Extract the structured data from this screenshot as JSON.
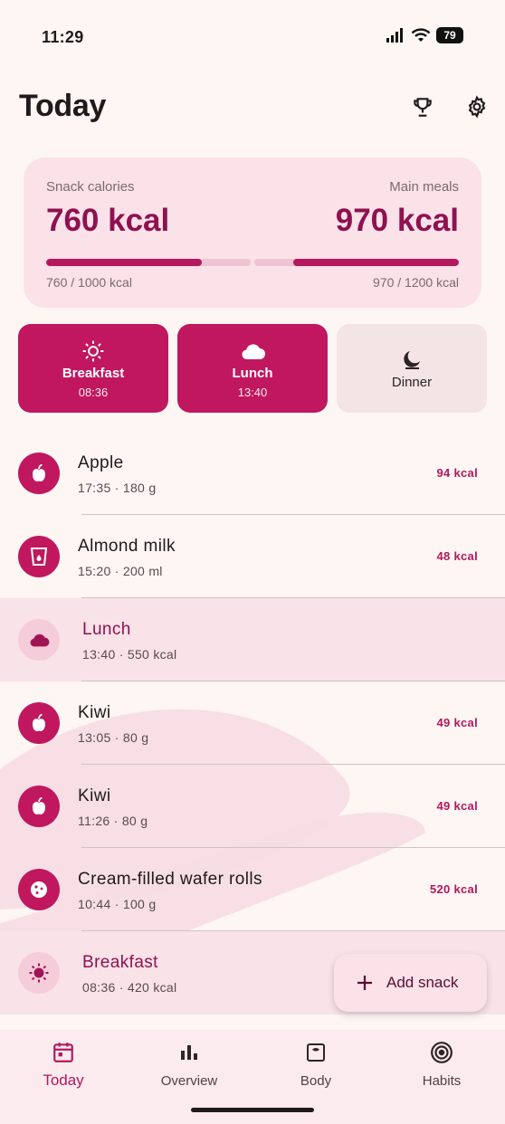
{
  "status_bar": {
    "time": "11:29",
    "battery": "79"
  },
  "header": {
    "title": "Today",
    "trophy_icon": "trophy-icon",
    "settings_icon": "gear-icon"
  },
  "summary": {
    "snack": {
      "label": "Snack calories",
      "value": "760 kcal",
      "progress_text": "760 / 1000 kcal",
      "progress": 0.76
    },
    "main": {
      "label": "Main meals",
      "value": "970 kcal",
      "progress_text": "970 / 1200 kcal",
      "progress": 0.81
    }
  },
  "meals": [
    {
      "name": "Breakfast",
      "time": "08:36",
      "status": "done",
      "icon": "sun-icon"
    },
    {
      "name": "Lunch",
      "time": "13:40",
      "status": "done",
      "icon": "cloud-icon"
    },
    {
      "name": "Dinner",
      "time": "",
      "status": "pending",
      "icon": "moon-icon"
    }
  ],
  "entries": [
    {
      "type": "snack",
      "name": "Apple",
      "sub": "17:35 · 180 g",
      "kcal": "94 kcal",
      "icon": "apple-icon"
    },
    {
      "type": "snack",
      "name": "Almond milk",
      "sub": "15:20 · 200 ml",
      "kcal": "48 kcal",
      "icon": "cup-icon"
    },
    {
      "type": "meal",
      "name": "Lunch",
      "sub": "13:40 · 550 kcal",
      "kcal": "",
      "icon": "cloud-icon"
    },
    {
      "type": "snack",
      "name": "Kiwi",
      "sub": "13:05 · 80 g",
      "kcal": "49 kcal",
      "icon": "apple-icon"
    },
    {
      "type": "snack",
      "name": "Kiwi",
      "sub": "11:26 · 80 g",
      "kcal": "49 kcal",
      "icon": "apple-icon"
    },
    {
      "type": "snack",
      "name": "Cream-filled wafer rolls",
      "sub": "10:44 · 100 g",
      "kcal": "520 kcal",
      "icon": "cookie-icon"
    },
    {
      "type": "meal",
      "name": "Breakfast",
      "sub": "08:36 · 420 kcal",
      "kcal": "",
      "icon": "sun-icon"
    }
  ],
  "fab": {
    "label": "Add snack",
    "icon": "plus-icon"
  },
  "nav": [
    {
      "label": "Today",
      "icon": "calendar-icon",
      "active": true
    },
    {
      "label": "Overview",
      "icon": "bar-chart-icon",
      "active": false
    },
    {
      "label": "Body",
      "icon": "scale-icon",
      "active": false
    },
    {
      "label": "Habits",
      "icon": "target-icon",
      "active": false
    }
  ],
  "colors": {
    "accent": "#c0175f",
    "accent_dark": "#8e1150",
    "card_bg": "#fbe1e8",
    "page_bg": "#fdf6f3"
  }
}
